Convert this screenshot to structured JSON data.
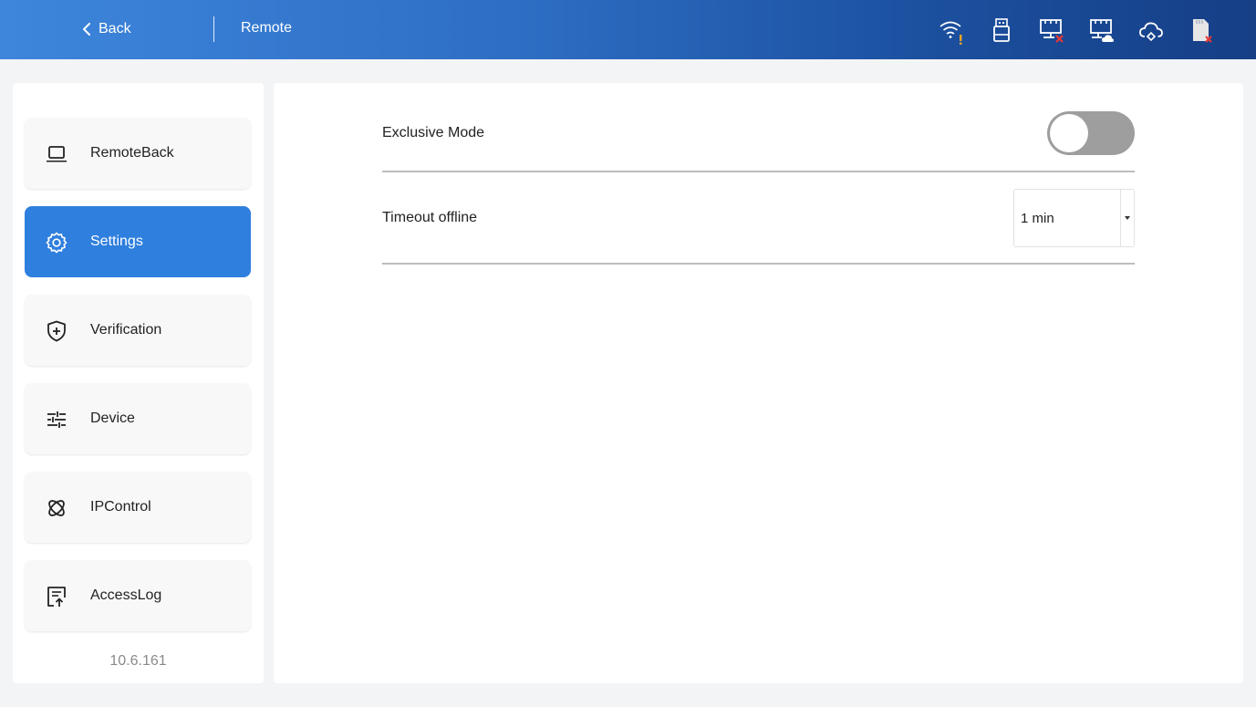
{
  "header": {
    "back_label": "Back",
    "title": "Remote",
    "status_icons": [
      "wifi-warning-icon",
      "usb-drive-icon",
      "lan-disconnected-icon",
      "cloud-lan-icon",
      "cloud-icon",
      "sd-card-error-icon"
    ]
  },
  "sidebar": {
    "items": [
      {
        "label": "RemoteBack",
        "icon": "laptop-icon"
      },
      {
        "label": "Settings",
        "icon": "gear-icon"
      },
      {
        "label": "Verification",
        "icon": "shield-plus-icon"
      },
      {
        "label": "Device",
        "icon": "sliders-icon"
      },
      {
        "label": "IPControl",
        "icon": "atom-icon"
      },
      {
        "label": "AccessLog",
        "icon": "document-upload-icon"
      }
    ],
    "active_item": "Settings",
    "version": "10.6.161"
  },
  "settings": {
    "exclusive_mode": {
      "label": "Exclusive Mode",
      "enabled": false
    },
    "timeout_offline": {
      "label": "Timeout offline",
      "value": "1 min"
    }
  },
  "colors": {
    "accent": "#2f7fde",
    "toggle_off": "#9e9e9e",
    "warning": "#f5a623",
    "error": "#e53935"
  }
}
